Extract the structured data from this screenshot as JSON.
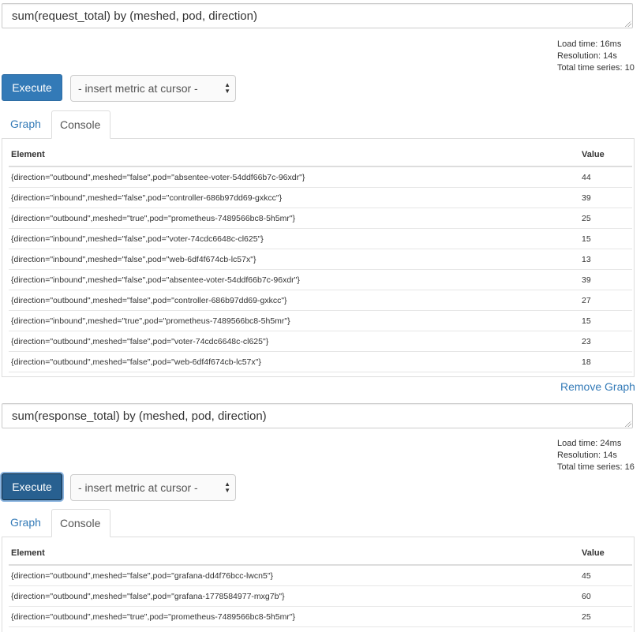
{
  "panels": [
    {
      "expression": "sum(request_total) by (meshed, pod, direction)",
      "stats": {
        "load_time": "Load time: 16ms",
        "resolution": "Resolution: 14s",
        "total_series": "Total time series: 10"
      },
      "execute_label": "Execute",
      "metric_select": "- insert metric at cursor -",
      "tabs": [
        "Graph",
        "Console"
      ],
      "columns": [
        "Element",
        "Value"
      ],
      "rows": [
        {
          "element": "{direction=\"outbound\",meshed=\"false\",pod=\"absentee-voter-54ddf66b7c-96xdr\"}",
          "value": "44"
        },
        {
          "element": "{direction=\"inbound\",meshed=\"false\",pod=\"controller-686b97dd69-gxkcc\"}",
          "value": "39"
        },
        {
          "element": "{direction=\"outbound\",meshed=\"true\",pod=\"prometheus-7489566bc8-5h5mr\"}",
          "value": "25"
        },
        {
          "element": "{direction=\"inbound\",meshed=\"false\",pod=\"voter-74cdc6648c-cl625\"}",
          "value": "15"
        },
        {
          "element": "{direction=\"inbound\",meshed=\"false\",pod=\"web-6df4f674cb-lc57x\"}",
          "value": "13"
        },
        {
          "element": "{direction=\"inbound\",meshed=\"false\",pod=\"absentee-voter-54ddf66b7c-96xdr\"}",
          "value": "39"
        },
        {
          "element": "{direction=\"outbound\",meshed=\"false\",pod=\"controller-686b97dd69-gxkcc\"}",
          "value": "27"
        },
        {
          "element": "{direction=\"inbound\",meshed=\"true\",pod=\"prometheus-7489566bc8-5h5mr\"}",
          "value": "15"
        },
        {
          "element": "{direction=\"outbound\",meshed=\"false\",pod=\"voter-74cdc6648c-cl625\"}",
          "value": "23"
        },
        {
          "element": "{direction=\"outbound\",meshed=\"false\",pod=\"web-6df4f674cb-lc57x\"}",
          "value": "18"
        }
      ],
      "remove_label": "Remove Graph"
    },
    {
      "expression": "sum(response_total) by (meshed, pod, direction)",
      "stats": {
        "load_time": "Load time: 24ms",
        "resolution": "Resolution: 14s",
        "total_series": "Total time series: 16"
      },
      "execute_label": "Execute",
      "metric_select": "- insert metric at cursor -",
      "tabs": [
        "Graph",
        "Console"
      ],
      "columns": [
        "Element",
        "Value"
      ],
      "rows": [
        {
          "element": "{direction=\"outbound\",meshed=\"false\",pod=\"grafana-dd4f76bcc-lwcn5\"}",
          "value": "45"
        },
        {
          "element": "{direction=\"outbound\",meshed=\"false\",pod=\"grafana-1778584977-mxg7b\"}",
          "value": "60"
        },
        {
          "element": "{direction=\"outbound\",meshed=\"true\",pod=\"prometheus-7489566bc8-5h5mr\"}",
          "value": "25"
        }
      ]
    }
  ],
  "colors": {
    "primary": "#337ab7",
    "primary_active": "#286090",
    "border": "#dddddd"
  }
}
